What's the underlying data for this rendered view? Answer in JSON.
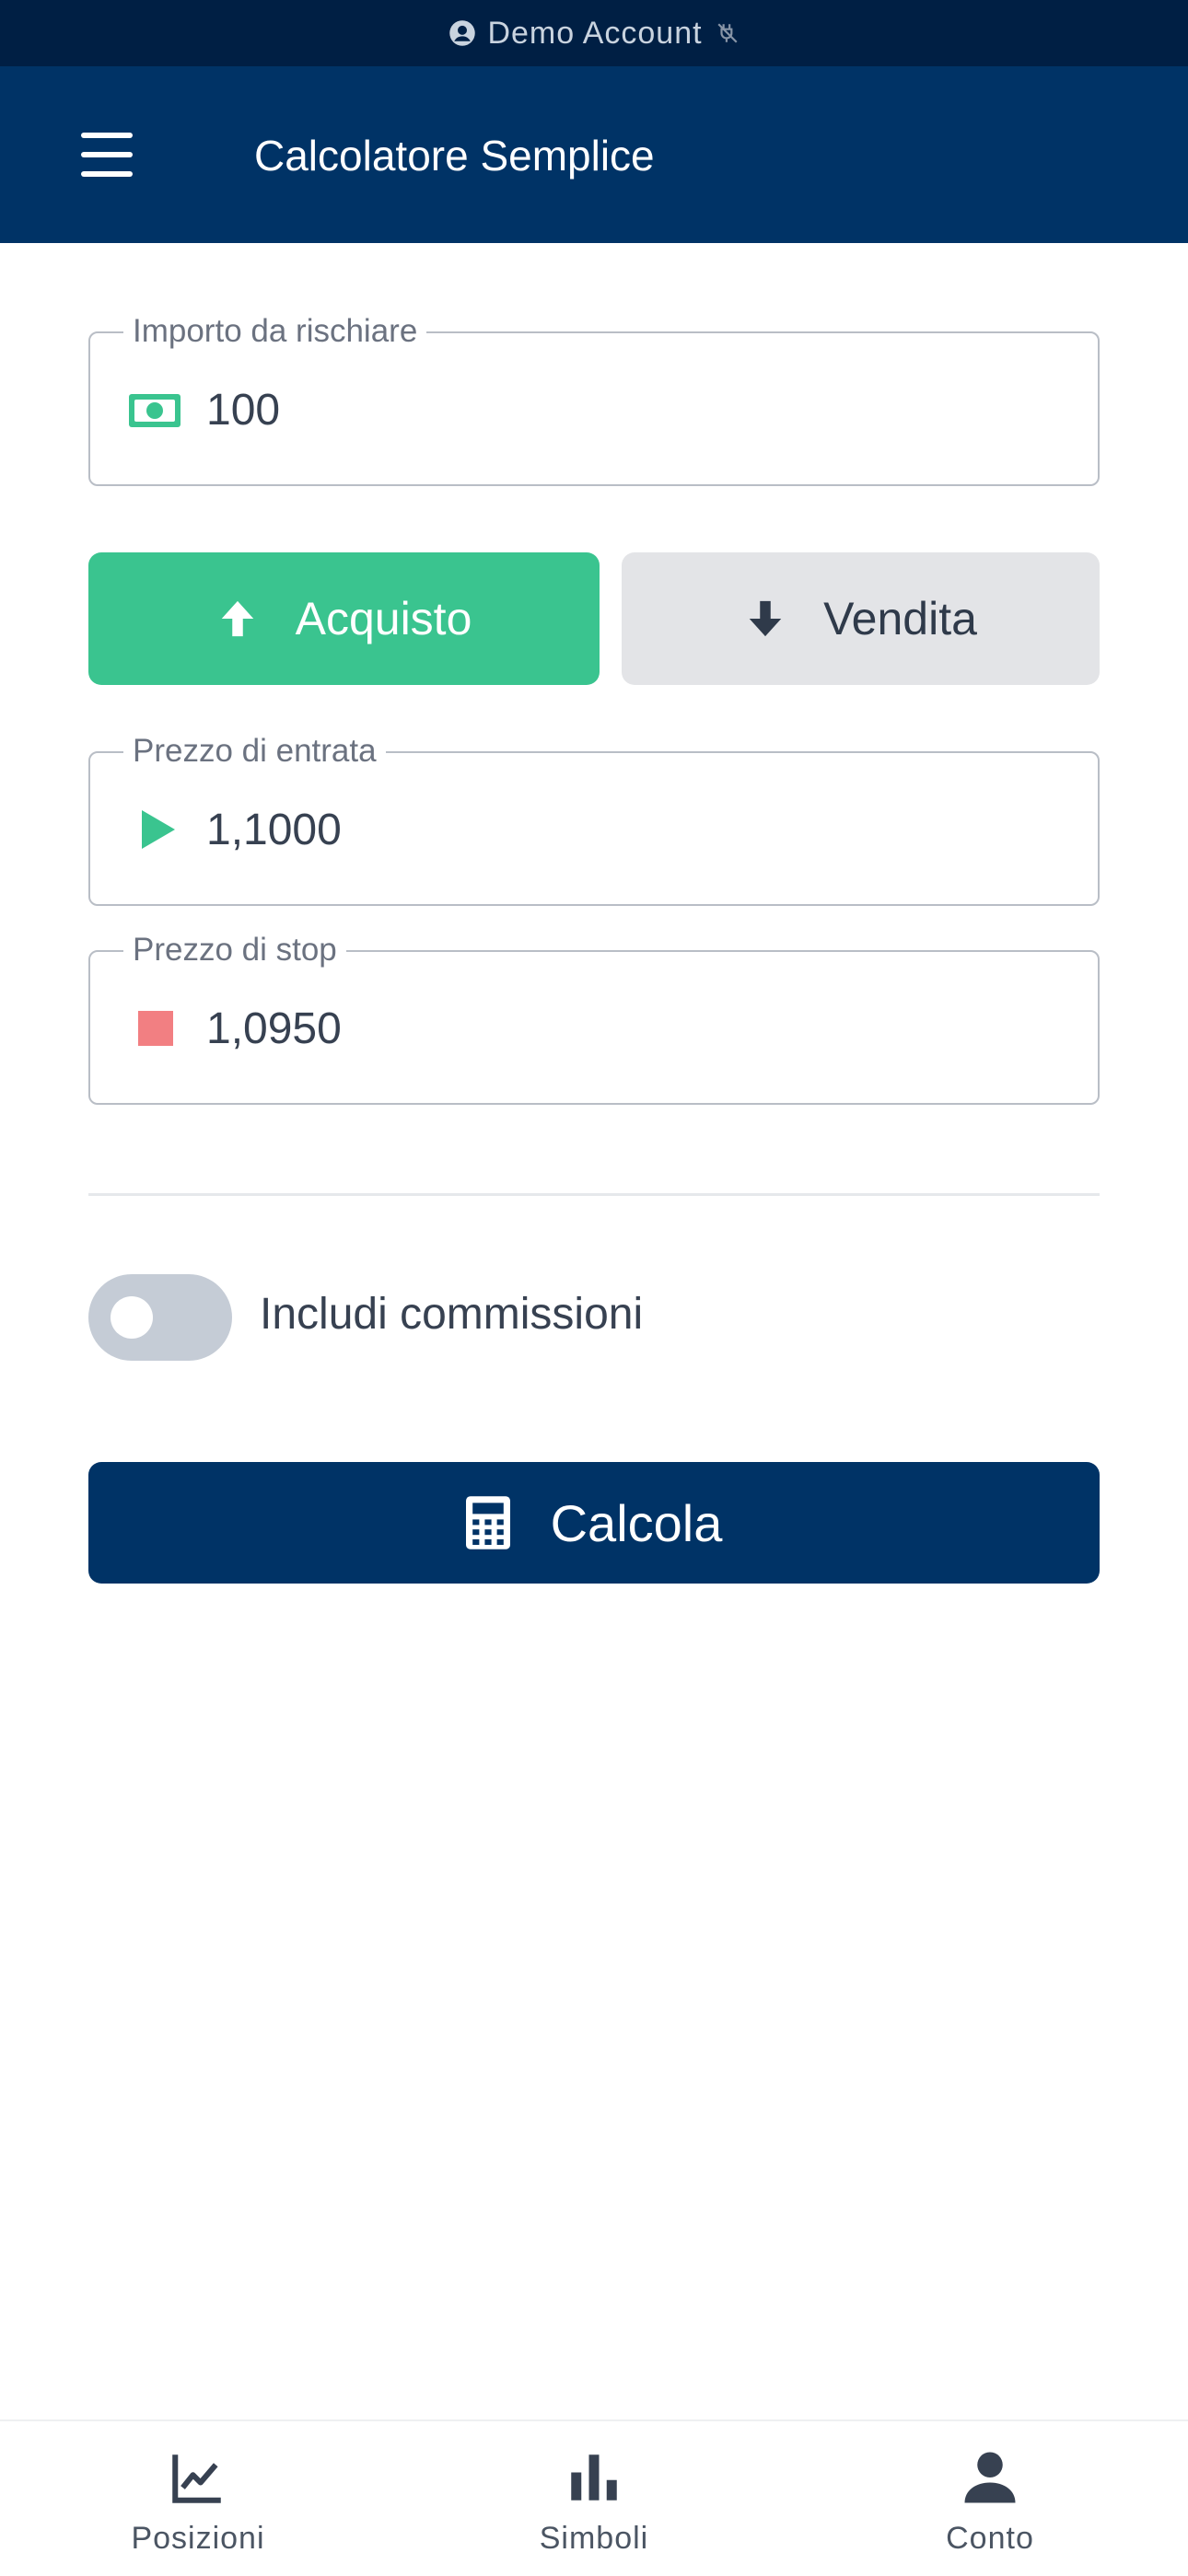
{
  "status_bar": {
    "account_label": "Demo Account"
  },
  "app_bar": {
    "title": "Calcolatore Semplice"
  },
  "form": {
    "risk_amount": {
      "label": "Importo da rischiare",
      "value": "100"
    },
    "direction": {
      "buy_label": "Acquisto",
      "sell_label": "Vendita",
      "selected": "Acquisto"
    },
    "entry_price": {
      "label": "Prezzo di entrata",
      "value": "1,1000"
    },
    "stop_price": {
      "label": "Prezzo di stop",
      "value": "1,0950"
    },
    "include_fees": {
      "label": "Includi commissioni",
      "checked": false
    },
    "calculate_label": "Calcola"
  },
  "bottom_nav": {
    "items": [
      {
        "label": "Posizioni",
        "icon": "line-chart-icon"
      },
      {
        "label": "Simboli",
        "icon": "bar-chart-icon"
      },
      {
        "label": "Conto",
        "icon": "person-icon"
      }
    ]
  },
  "colors": {
    "primary": "#003366",
    "status_bar": "#001f44",
    "buy": "#3ac48f",
    "sell_bg": "#e3e4e7",
    "stop_marker": "#f27f82"
  }
}
